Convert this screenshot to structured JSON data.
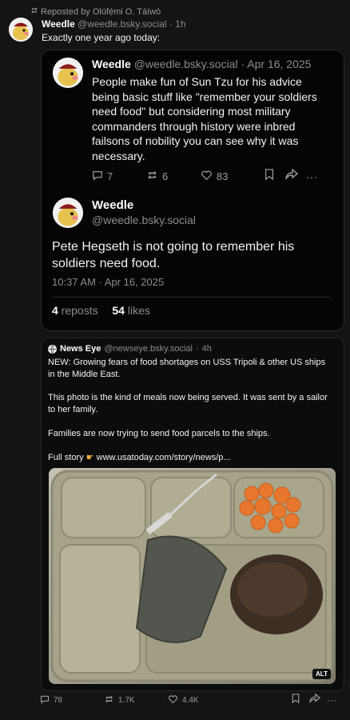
{
  "repost": {
    "label": "Reposted by Olúfẹ́mi O. Táíwò"
  },
  "top_post": {
    "author": "Weedle",
    "handle": "@weedle.bsky.social",
    "time": "1h",
    "text": "Exactly one year ago today:"
  },
  "quoted_post": {
    "author": "Weedle",
    "handle": "@weedle.bsky.social",
    "date": "Apr 16, 2025",
    "text": "People make fun of Sun Tzu for his advice being basic stuff like \"remember your soldiers need food\" but considering most military commanders through history were inbred failsons of nobility you can see why it was necessary.",
    "replies": "7",
    "reposts": "6",
    "likes": "83"
  },
  "focused_post": {
    "author": "Weedle",
    "handle": "@weedle.bsky.social",
    "text": "Pete Hegseth is not going to remember his soldiers need food.",
    "timestamp": "10:37 AM · Apr 16, 2025",
    "reposts_count": "4",
    "reposts_label": "reposts",
    "likes_count": "54",
    "likes_label": "likes"
  },
  "news_post": {
    "author": "News Eye",
    "handle": "@newseye.bsky.social",
    "time": "4h",
    "para1": "NEW: Growing fears of food shortages on USS Tripoli & other US ships in the Middle East.",
    "para2": "This photo is the kind of meals now being served. It was sent by a sailor to her family.",
    "para3": "Families are now trying to send food parcels to the ships.",
    "full_story_label": "Full story",
    "link": "www.usatoday.com/story/news/p...",
    "alt_badge": "ALT"
  },
  "bottom_actions": {
    "replies": "78",
    "reposts": "1.7K",
    "likes": "4.4K"
  },
  "colors": {
    "background": "#141414",
    "card": "#050505",
    "text": "#f2f2f2",
    "muted": "#8b8b8b"
  }
}
